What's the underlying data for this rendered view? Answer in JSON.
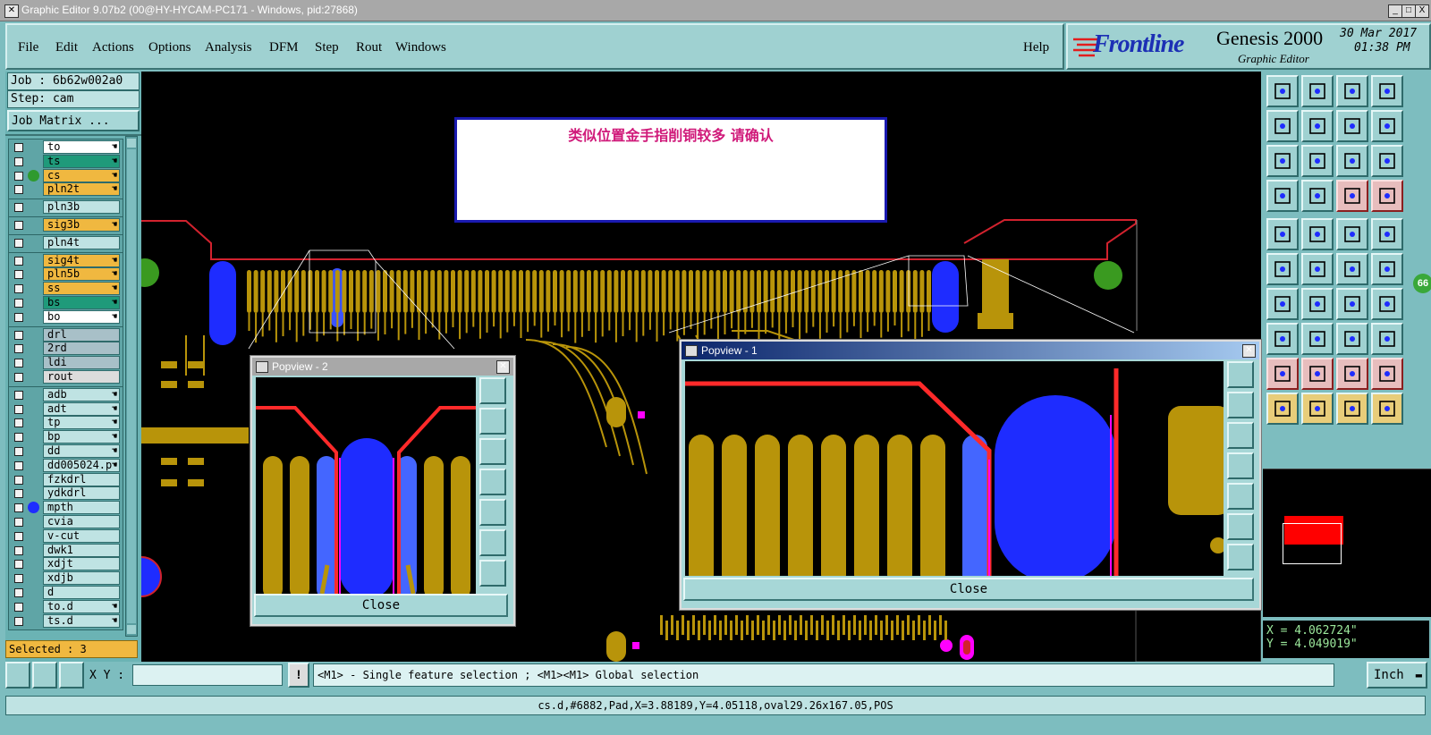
{
  "window": {
    "title": "Graphic Editor 9.07b2 (00@HY-HYCAM-PC171 - Windows, pid:27868)",
    "minimize": "_",
    "maximize": "□",
    "close": "X"
  },
  "menu": {
    "items": [
      "File",
      "Edit",
      "Actions",
      "Options",
      "Analysis",
      "DFM",
      "Step",
      "Rout",
      "Windows"
    ],
    "help": "Help"
  },
  "brand": {
    "logo": "Frontline",
    "product": "Genesis 2000",
    "subtitle": "Graphic Editor",
    "date": "30 Mar 2017",
    "time": "01:38 PM"
  },
  "job": {
    "job_label": "Job : 6b62w002a0",
    "step_label": "Step: cam",
    "matrix_button": "Job Matrix ..."
  },
  "layers": [
    {
      "name": "to",
      "color": "#ffffff",
      "hand": true
    },
    {
      "name": "ts",
      "color": "#1f9a7a",
      "hand": true
    },
    {
      "name": "cs",
      "color": "#f0b840",
      "hand": true,
      "dot": "#2f9a2f"
    },
    {
      "name": "pln2t",
      "color": "#f0b840",
      "hand": true
    },
    {
      "name": "pln3b",
      "color": "#bfe3e3",
      "hand": false
    },
    {
      "name": "sig3b",
      "color": "#f0b840",
      "hand": true
    },
    {
      "name": "pln4t",
      "color": "#bfe3e3",
      "hand": false
    },
    {
      "name": "sig4t",
      "color": "#f0b840",
      "hand": true
    },
    {
      "name": "pln5b",
      "color": "#f0b840",
      "hand": true
    },
    {
      "name": "ss",
      "color": "#f0b840",
      "hand": true
    },
    {
      "name": "bs",
      "color": "#1f9a7a",
      "hand": true
    },
    {
      "name": "bo",
      "color": "#ffffff",
      "hand": true
    },
    {
      "name": "drl",
      "color": "#a8c0c8",
      "hand": false
    },
    {
      "name": "2rd",
      "color": "#a8c0c8",
      "hand": false
    },
    {
      "name": "ldi",
      "color": "#a8c0c8",
      "hand": false
    },
    {
      "name": "rout",
      "color": "#dcdcdc",
      "hand": false
    },
    {
      "name": "adb",
      "color": "#bfe3e3",
      "hand": true
    },
    {
      "name": "adt",
      "color": "#bfe3e3",
      "hand": true
    },
    {
      "name": "tp",
      "color": "#bfe3e3",
      "hand": true
    },
    {
      "name": "bp",
      "color": "#bfe3e3",
      "hand": true
    },
    {
      "name": "dd",
      "color": "#bfe3e3",
      "hand": true
    },
    {
      "name": "dd005024.p",
      "color": "#bfe3e3",
      "hand": true
    },
    {
      "name": "fzkdrl",
      "color": "#bfe3e3",
      "hand": false
    },
    {
      "name": "ydkdrl",
      "color": "#bfe3e3",
      "hand": false
    },
    {
      "name": "mpth",
      "color": "#bfe3e3",
      "hand": false,
      "dot": "#1e2cff"
    },
    {
      "name": "cvia",
      "color": "#bfe3e3",
      "hand": false
    },
    {
      "name": "v-cut",
      "color": "#bfe3e3",
      "hand": false
    },
    {
      "name": "dwk1",
      "color": "#bfe3e3",
      "hand": false
    },
    {
      "name": "xdjt",
      "color": "#bfe3e3",
      "hand": false
    },
    {
      "name": "xdjb",
      "color": "#bfe3e3",
      "hand": false
    },
    {
      "name": "d",
      "color": "#bfe3e3",
      "hand": false
    },
    {
      "name": "to.d",
      "color": "#bfe3e3",
      "hand": true
    },
    {
      "name": "ts.d",
      "color": "#bfe3e3",
      "hand": true
    }
  ],
  "selected": "Selected : 3",
  "note": "类似位置金手指削铜较多   请确认",
  "popup2": {
    "title": "Popview - 2",
    "close": "Close"
  },
  "popup1": {
    "title": "Popview - 1",
    "close": "Close"
  },
  "coords": {
    "x": "X = 4.062724\"",
    "y": "Y = 4.049019\""
  },
  "badge": "66",
  "bottom": {
    "xy_label": "X Y :",
    "xy_value": "",
    "bang": "!",
    "hint": "<M1> - Single feature selection ; <M1><M1> Global selection",
    "units": "Inch"
  },
  "status": "cs.d,#6882,Pad,X=3.88189,Y=4.05118,oval29.26x167.05,POS"
}
